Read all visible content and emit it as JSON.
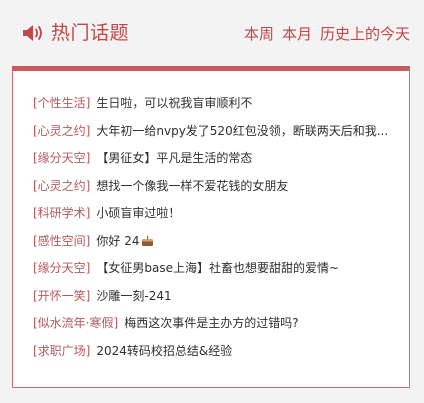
{
  "header": {
    "title": "热门话题",
    "icon": "speaker-icon",
    "accent_color": "#c0474a"
  },
  "tabs": [
    {
      "label": "本周"
    },
    {
      "label": "本月"
    },
    {
      "label": "历史上的今天"
    }
  ],
  "topics": [
    {
      "category": "[个性生活]",
      "text": "生日啦，可以祝我盲审顺利不"
    },
    {
      "category": "[心灵之约]",
      "text": "大年初一给nvpy发了520红包没领，断联两天后和我..."
    },
    {
      "category": "[缘分天空]",
      "text": "【男征女】平凡是生活的常态"
    },
    {
      "category": "[心灵之约]",
      "text": "想找一个像我一样不爱花钱的女朋友"
    },
    {
      "category": "[科研学术]",
      "text": "小硕盲审过啦！"
    },
    {
      "category": "[感性空间]",
      "text": "你好 24",
      "icon": "cake-icon"
    },
    {
      "category": "[缘分天空]",
      "text": "【女征男base上海】社畜也想要甜甜的爱情~"
    },
    {
      "category": "[开怀一笑]",
      "text": "沙雕一刻-241"
    },
    {
      "category": "[似水流年·寒假]",
      "text": "梅西这次事件是主办方的过错吗?"
    },
    {
      "category": "[求职广场]",
      "text": "2024转码校招总结&经验"
    }
  ]
}
